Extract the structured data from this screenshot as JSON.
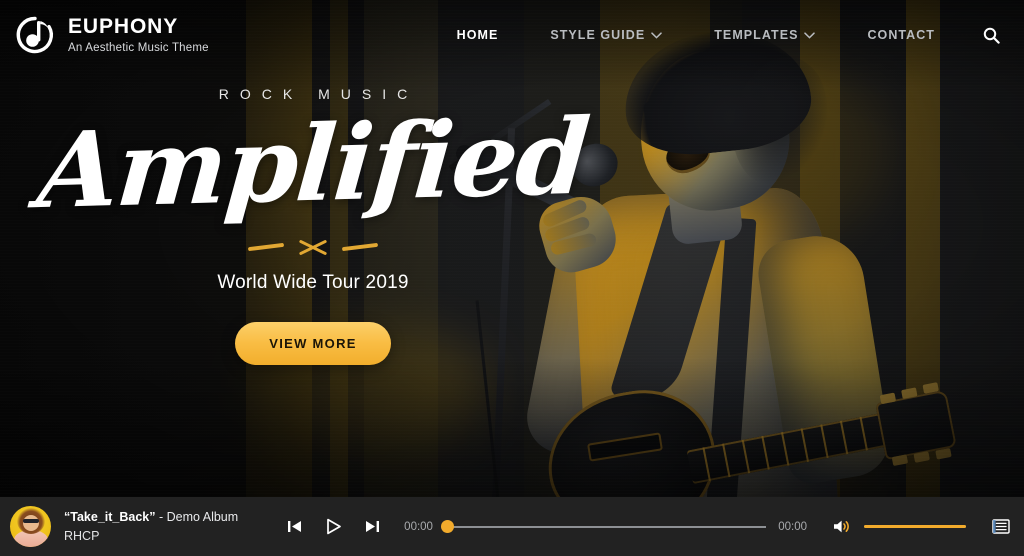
{
  "header": {
    "logo_icon": "music-note-circle-icon",
    "brand_title": "EUPHONY",
    "brand_subtitle": "An Aesthetic Music Theme",
    "nav": [
      {
        "label": "HOME",
        "active": true,
        "has_caret": false
      },
      {
        "label": "STYLE GUIDE",
        "active": false,
        "has_caret": true
      },
      {
        "label": "TEMPLATES",
        "active": false,
        "has_caret": true
      },
      {
        "label": "CONTACT",
        "active": false,
        "has_caret": false
      }
    ],
    "caret_glyph": "⌄",
    "search_icon": "search-icon"
  },
  "hero": {
    "eyebrow": "ROCK MUSIC",
    "headline": "Amplified",
    "divider_icon": "crossed-drumsticks-icon",
    "subheadline": "World Wide Tour 2019",
    "cta_label": "VIEW MORE",
    "background": "duotone-photo-singer-with-microphone-and-guitar"
  },
  "player": {
    "avatar_icon": "track-artwork-avatar",
    "track_title": "“Take_it_Back”",
    "track_separator": " - ",
    "track_album": "Demo Album",
    "track_artist": "RHCP",
    "previous_icon": "previous-track-icon",
    "play_icon": "play-icon",
    "next_icon": "next-track-icon",
    "elapsed_time": "00:00",
    "total_time": "00:00",
    "progress_percent": 0,
    "volume_icon": "volume-icon",
    "volume_percent": 100,
    "playlist_icon": "playlist-icon"
  },
  "colors": {
    "accent": "#f2ab2c",
    "accent_light": "#fcd06a",
    "player_bg": "#222222",
    "text_light": "#ffffff",
    "text_muted": "#b9bcc0"
  }
}
